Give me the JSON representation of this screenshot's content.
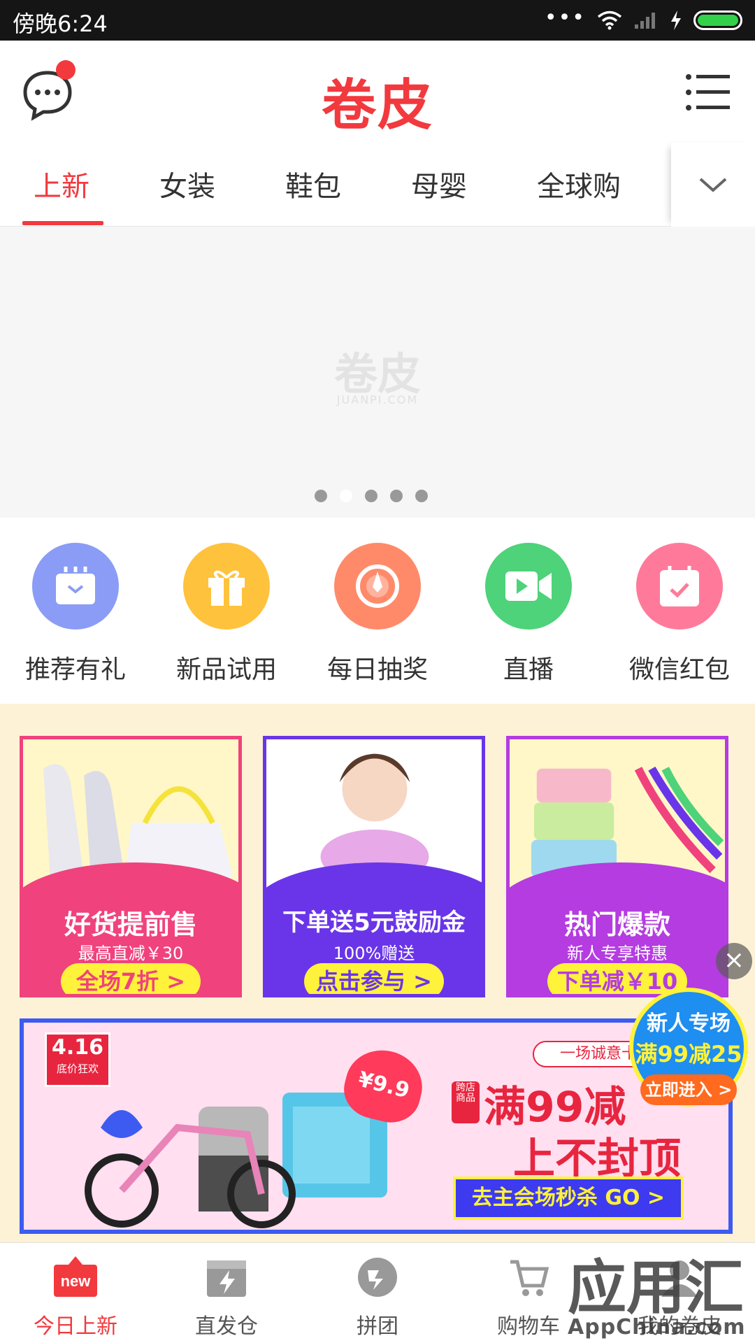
{
  "status_bar": {
    "time": "傍晚6:24",
    "dots": "•••"
  },
  "header": {
    "title": "卷皮"
  },
  "tabs": [
    {
      "label": "上新",
      "active": true
    },
    {
      "label": "女装"
    },
    {
      "label": "鞋包"
    },
    {
      "label": "母婴"
    },
    {
      "label": "全球购"
    }
  ],
  "banner": {
    "placeholder_logo": "卷皮",
    "placeholder_sub": "JUANPI.COM",
    "page_count": 5,
    "current_page": 2
  },
  "quick_links": [
    {
      "label": "推荐有礼",
      "icon": "envelope-icon",
      "color": "#8a9cf5"
    },
    {
      "label": "新品试用",
      "icon": "gift-icon",
      "color": "#ffc23c"
    },
    {
      "label": "每日抽奖",
      "icon": "lottery-icon",
      "color": "#ff8a6a"
    },
    {
      "label": "直播",
      "icon": "video-icon",
      "color": "#4ed27a"
    },
    {
      "label": "微信红包",
      "icon": "calendar-check-icon",
      "color": "#ff7a9a"
    }
  ],
  "promo_cards": [
    {
      "title": "好货提前售",
      "subtitle": "最高直减￥30",
      "button": "全场7折 >",
      "color": "#f0427d"
    },
    {
      "title": "下单送5元鼓励金",
      "subtitle": "100%赠送",
      "button": "点击参与 >",
      "color": "#6a35e8"
    },
    {
      "title": "热门爆款",
      "subtitle": "新人专享特惠",
      "button": "下单减￥10",
      "color": "#b43ce0"
    }
  ],
  "big_banner": {
    "date": "4.16",
    "date_sub": "底价狂欢",
    "price_tag": "¥9.9",
    "slogan": "一场诚意十足",
    "cross_tag": "跨店商品",
    "headline1": "满99减",
    "headline2": "上不封顶",
    "cta": "去主会场秒杀 GO >"
  },
  "float_badge": {
    "line1": "新人专场",
    "line2": "满99减25",
    "button": "立即进入 >"
  },
  "close_symbol": "×",
  "bottom_nav": [
    {
      "label": "今日上新",
      "active": true,
      "icon_text": "new"
    },
    {
      "label": "直发仓"
    },
    {
      "label": "拼团"
    },
    {
      "label": "购物车"
    },
    {
      "label": "我的卷皮"
    }
  ],
  "watermark": {
    "text": "应用汇",
    "sub": "AppChina.com"
  },
  "colors": {
    "brand_red": "#f2393e",
    "promo_bg": "#fdf2d6"
  }
}
